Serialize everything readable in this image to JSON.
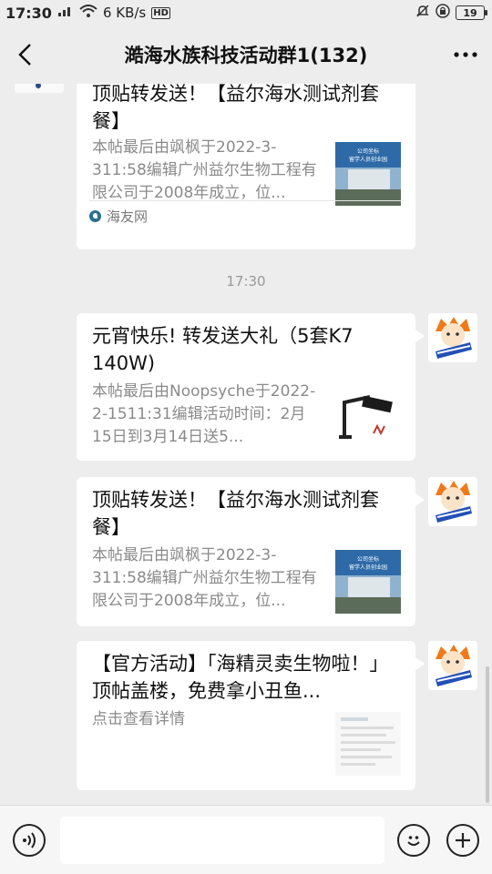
{
  "status_bar": {
    "time": "17:30",
    "net_speed": "6 KB/s",
    "hd": "HD",
    "battery": "19"
  },
  "header": {
    "title": "澔海水族科技活动群1(132)"
  },
  "messages": [
    {
      "title": "顶贴转发送！【益尔海水测试剂套餐】",
      "desc": "本帖最后由飒枫于2022-3-311:58编辑广州益尔生物工程有限公司于2008年成立，位...",
      "source": "海友网"
    },
    {
      "timestamp": "17:30"
    },
    {
      "title": "元宵快乐! 转发送大礼（5套K7 140W)",
      "desc": "本帖最后由Noopsyche于2022-2-1511:31编辑活动时间：2月15日到3月14日送5..."
    },
    {
      "title": "顶贴转发送！【益尔海水测试剂套餐】",
      "desc": "本帖最后由飒枫于2022-3-311:58编辑广州益尔生物工程有限公司于2008年成立，位..."
    },
    {
      "title": "【官方活动】「海精灵卖生物啦！」顶帖盖楼，免费拿小丑鱼...",
      "desc": "点击查看详情"
    }
  ],
  "thumb_texts": {
    "company_line1": "公司坐标",
    "company_line2": "留学人员创业园"
  },
  "input": {
    "value": ""
  },
  "colors": {
    "background": "#ededed",
    "card": "#ffffff",
    "desc_text": "#8a8a8a"
  },
  "icons": [
    "back-arrow-icon",
    "more-icon",
    "voice-icon",
    "emoji-icon",
    "add-icon"
  ]
}
